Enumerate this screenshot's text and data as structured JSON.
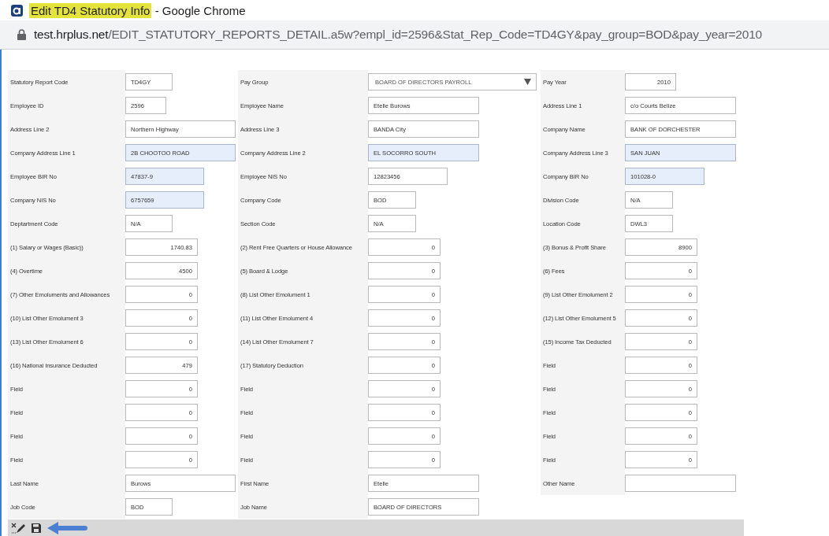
{
  "window": {
    "title_highlight": "Edit TD4 Statutory Info",
    "title_rest": "- Google Chrome"
  },
  "address_bar": {
    "host": "test.hrplus.net",
    "path": "/EDIT_STATUTORY_REPORTS_DETAIL.a5w?empl_id=2596&Stat_Rep_Code=TD4GY&pay_group=BOD&pay_year=2010"
  },
  "form": {
    "rows": [
      [
        {
          "label": "Statutory Report Code",
          "value": "TD4GY",
          "kind": "text",
          "shaded": false
        },
        {
          "label": "Pay Group",
          "value": "BOARD OF DIRECTORS PAYROLL",
          "kind": "select",
          "shaded": false
        },
        {
          "label": "Pay Year",
          "value": "2010",
          "kind": "number",
          "shaded": false
        }
      ],
      [
        {
          "label": "Employee ID",
          "value": "2596",
          "kind": "text",
          "shaded": false
        },
        {
          "label": "Employee Name",
          "value": "Etelle Burows",
          "kind": "text",
          "shaded": false
        },
        {
          "label": "Address Line 1",
          "value": "c/o Courts Belize",
          "kind": "text",
          "shaded": false
        }
      ],
      [
        {
          "label": "Address Line 2",
          "value": "Northern Highway",
          "kind": "text",
          "shaded": false
        },
        {
          "label": "Address Line 3",
          "value": "BANDA City",
          "kind": "text",
          "shaded": false
        },
        {
          "label": "Company Name",
          "value": "BANK OF DORCHESTER",
          "kind": "text",
          "shaded": false
        }
      ],
      [
        {
          "label": "Company Address Line 1",
          "value": "2B CHOOTOO ROAD",
          "kind": "text",
          "shaded": true
        },
        {
          "label": "Company Address Line 2",
          "value": "EL SOCORRO SOUTH",
          "kind": "text",
          "shaded": true
        },
        {
          "label": "Company Address Line 3",
          "value": "SAN JUAN",
          "kind": "text",
          "shaded": true
        }
      ],
      [
        {
          "label": "Employee BIR No",
          "value": "47837-9",
          "kind": "text",
          "shaded": true
        },
        {
          "label": "Employee NIS No",
          "value": "12823456",
          "kind": "text",
          "shaded": false
        },
        {
          "label": "Company BIR No",
          "value": "101028-0",
          "kind": "text",
          "shaded": true
        }
      ],
      [
        {
          "label": "Company NIS No",
          "value": "6757659",
          "kind": "text",
          "shaded": true
        },
        {
          "label": "Company Code",
          "value": "BOD",
          "kind": "text",
          "shaded": false
        },
        {
          "label": "Division Code",
          "value": "N/A",
          "kind": "text",
          "shaded": false
        }
      ],
      [
        {
          "label": "Deptartment Code",
          "value": "N/A",
          "kind": "text",
          "shaded": false
        },
        {
          "label": "Section Code",
          "value": "N/A",
          "kind": "text",
          "shaded": false
        },
        {
          "label": "Location Code",
          "value": "DWL3",
          "kind": "text",
          "shaded": false
        }
      ],
      [
        {
          "label": "(1) Salary or Wages (Basic))",
          "value": "1740.83",
          "kind": "number",
          "shaded": false
        },
        {
          "label": "(2) Rent Free Quarters or House Allowance",
          "value": "0",
          "kind": "number",
          "shaded": false
        },
        {
          "label": "(3) Bonus & Profit Share",
          "value": "8900",
          "kind": "number",
          "shaded": false
        }
      ],
      [
        {
          "label": "(4) Overtime",
          "value": "4500",
          "kind": "number",
          "shaded": false
        },
        {
          "label": "(5) Board & Lodge",
          "value": "0",
          "kind": "number",
          "shaded": false
        },
        {
          "label": "(6) Fees",
          "value": "0",
          "kind": "number",
          "shaded": false
        }
      ],
      [
        {
          "label": "(7) Other Emoluments and Allowances",
          "value": "0",
          "kind": "number",
          "shaded": false
        },
        {
          "label": "(8) List Other Emolument 1",
          "value": "0",
          "kind": "number",
          "shaded": false
        },
        {
          "label": "(9) List Other Emolument 2",
          "value": "0",
          "kind": "number",
          "shaded": false
        }
      ],
      [
        {
          "label": "(10) List Other Emolument 3",
          "value": "0",
          "kind": "number",
          "shaded": false
        },
        {
          "label": "(11) List Other Emolument 4",
          "value": "0",
          "kind": "number",
          "shaded": false
        },
        {
          "label": "(12) List Other Emolument 5",
          "value": "0",
          "kind": "number",
          "shaded": false
        }
      ],
      [
        {
          "label": "(13) List Other Emolument 6",
          "value": "0",
          "kind": "number",
          "shaded": false
        },
        {
          "label": "(14) List Other Emolument 7",
          "value": "0",
          "kind": "number",
          "shaded": false
        },
        {
          "label": "(15) Income Tax Deducted",
          "value": "0",
          "kind": "number",
          "shaded": false
        }
      ],
      [
        {
          "label": "(16) National Insurance Deducted",
          "value": "479",
          "kind": "number",
          "shaded": false
        },
        {
          "label": "(17) Statutory Deduction",
          "value": "0",
          "kind": "number",
          "shaded": false
        },
        {
          "label": "Field",
          "value": "0",
          "kind": "number",
          "shaded": false
        }
      ],
      [
        {
          "label": "Field",
          "value": "0",
          "kind": "number",
          "shaded": false
        },
        {
          "label": "Field",
          "value": "0",
          "kind": "number",
          "shaded": false
        },
        {
          "label": "Field",
          "value": "0",
          "kind": "number",
          "shaded": false
        }
      ],
      [
        {
          "label": "Field",
          "value": "0",
          "kind": "number",
          "shaded": false
        },
        {
          "label": "Field",
          "value": "0",
          "kind": "number",
          "shaded": false
        },
        {
          "label": "Field",
          "value": "0",
          "kind": "number",
          "shaded": false
        }
      ],
      [
        {
          "label": "Field",
          "value": "0",
          "kind": "number",
          "shaded": false
        },
        {
          "label": "Field",
          "value": "0",
          "kind": "number",
          "shaded": false
        },
        {
          "label": "Field",
          "value": "0",
          "kind": "number",
          "shaded": false
        }
      ],
      [
        {
          "label": "Field",
          "value": "0",
          "kind": "number",
          "shaded": false
        },
        {
          "label": "Field",
          "value": "0",
          "kind": "number",
          "shaded": false
        },
        {
          "label": "Field",
          "value": "0",
          "kind": "number",
          "shaded": false
        }
      ],
      [
        {
          "label": "Last Name",
          "value": "Burows",
          "kind": "text",
          "shaded": false
        },
        {
          "label": "First Name",
          "value": "Etelle",
          "kind": "text",
          "shaded": false
        },
        {
          "label": "Other Name",
          "kind": "text",
          "shaded": false
        }
      ],
      [
        {
          "label": "Job Code",
          "value": "BOD",
          "kind": "text",
          "shaded": false
        },
        {
          "label": "Job Name",
          "value": "BOARD OF DIRECTORS",
          "kind": "text",
          "shaded": false
        }
      ]
    ]
  }
}
